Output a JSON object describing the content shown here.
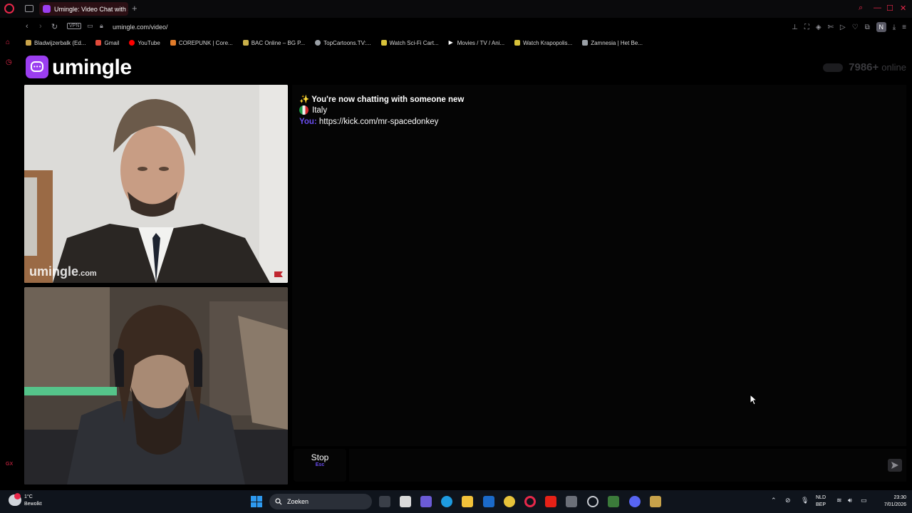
{
  "browser": {
    "tab_title": "Umingle: Video Chat with S",
    "url": "umingle.com/video/",
    "vpn_label": "VPN",
    "profile_initial": "N",
    "bookmarks": [
      {
        "label": "Bladwijzerbalk (Ed...",
        "icon_color": "#c9a44a"
      },
      {
        "label": "Gmail",
        "icon_color": "#e24b3b"
      },
      {
        "label": "YouTube",
        "icon_color": "#ff0000"
      },
      {
        "label": "COREPUNK | Core...",
        "icon_color": "#e07b2a"
      },
      {
        "label": "BAC Online – BG P...",
        "icon_color": "#c9b04a"
      },
      {
        "label": "TopCartoons.TV:...",
        "icon_color": "#9aa0a6"
      },
      {
        "label": "Watch Sci-Fi Cart...",
        "icon_color": "#d8c23a"
      },
      {
        "label": "Movies / TV / Ani...",
        "icon_color": "#ffffff"
      },
      {
        "label": "Watch Krapopolis...",
        "icon_color": "#d8c23a"
      },
      {
        "label": "Zamnesia | Het Be...",
        "icon_color": "#9aa0a6"
      }
    ]
  },
  "site": {
    "logo_text": "umingle",
    "online_count": "7986+",
    "online_label": "online",
    "watermark_main": "umingle",
    "watermark_suffix": ".com"
  },
  "chat": {
    "system_message": "✨ You're now chatting with someone new",
    "country": "Italy",
    "me_label": "You:",
    "me_message": "https://kick.com/mr-spacedonkey"
  },
  "controls": {
    "stop_label": "Stop",
    "stop_hint": "Esc",
    "message_placeholder": ""
  },
  "taskbar": {
    "weather_temp": "1°C",
    "weather_desc": "Bewolkt",
    "search_label": "Zoeken",
    "lang_top": "NLD",
    "lang_bottom": "BEP",
    "time": "23:30",
    "date": "7/01/2026"
  },
  "colors": {
    "accent": "#9b3ef0",
    "opera_red": "#e8284a",
    "you_label": "#6a4df0"
  }
}
